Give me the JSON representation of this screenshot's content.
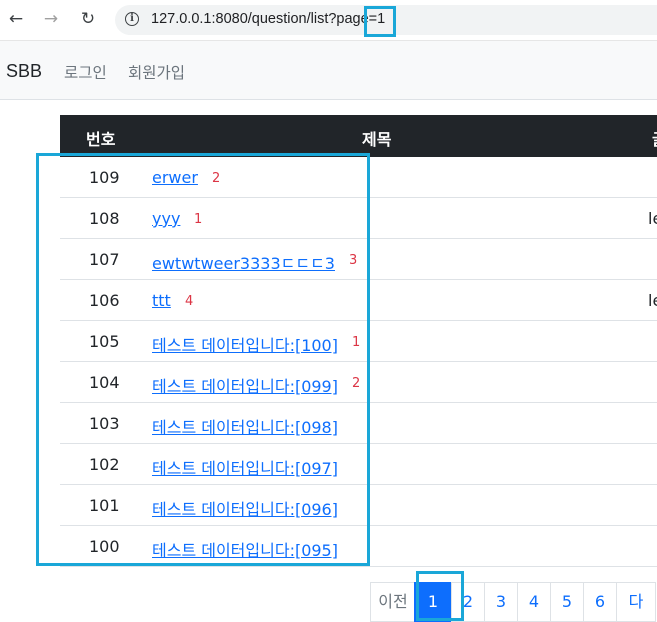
{
  "browser": {
    "url": "127.0.0.1:8080/question/list?page=1",
    "back_icon": "←",
    "forward_icon": "→",
    "reload_icon": "↻",
    "info_icon": "i"
  },
  "navbar": {
    "brand": "SBB",
    "login": "로그인",
    "signup": "회원가입"
  },
  "table": {
    "headers": {
      "number": "번호",
      "title": "제목",
      "extra": "글"
    },
    "rows": [
      {
        "number": "109",
        "title": "erwer",
        "answers": "2",
        "author": ""
      },
      {
        "number": "108",
        "title": "yyy",
        "answers": "1",
        "author": "le"
      },
      {
        "number": "107",
        "title": "ewtwtweer3333ㄷㄷㄷ3",
        "answers": "3",
        "author": ""
      },
      {
        "number": "106",
        "title": "ttt",
        "answers": "4",
        "author": "le"
      },
      {
        "number": "105",
        "title": "테스트 데이터입니다:[100]",
        "answers": "1",
        "author": ""
      },
      {
        "number": "104",
        "title": "테스트 데이터입니다:[099]",
        "answers": "2",
        "author": ""
      },
      {
        "number": "103",
        "title": "테스트 데이터입니다:[098]",
        "answers": "",
        "author": ""
      },
      {
        "number": "102",
        "title": "테스트 데이터입니다:[097]",
        "answers": "",
        "author": ""
      },
      {
        "number": "101",
        "title": "테스트 데이터입니다:[096]",
        "answers": "",
        "author": ""
      },
      {
        "number": "100",
        "title": "테스트 데이터입니다:[095]",
        "answers": "",
        "author": ""
      }
    ]
  },
  "pagination": {
    "prev": "이전",
    "pages": [
      "1",
      "2",
      "3",
      "4",
      "5",
      "6"
    ],
    "active": "1",
    "next": "다"
  },
  "colors": {
    "highlight": "#1aa7d8",
    "link": "#0d6efd",
    "answer_count": "#dc3545",
    "table_header": "#212529"
  }
}
